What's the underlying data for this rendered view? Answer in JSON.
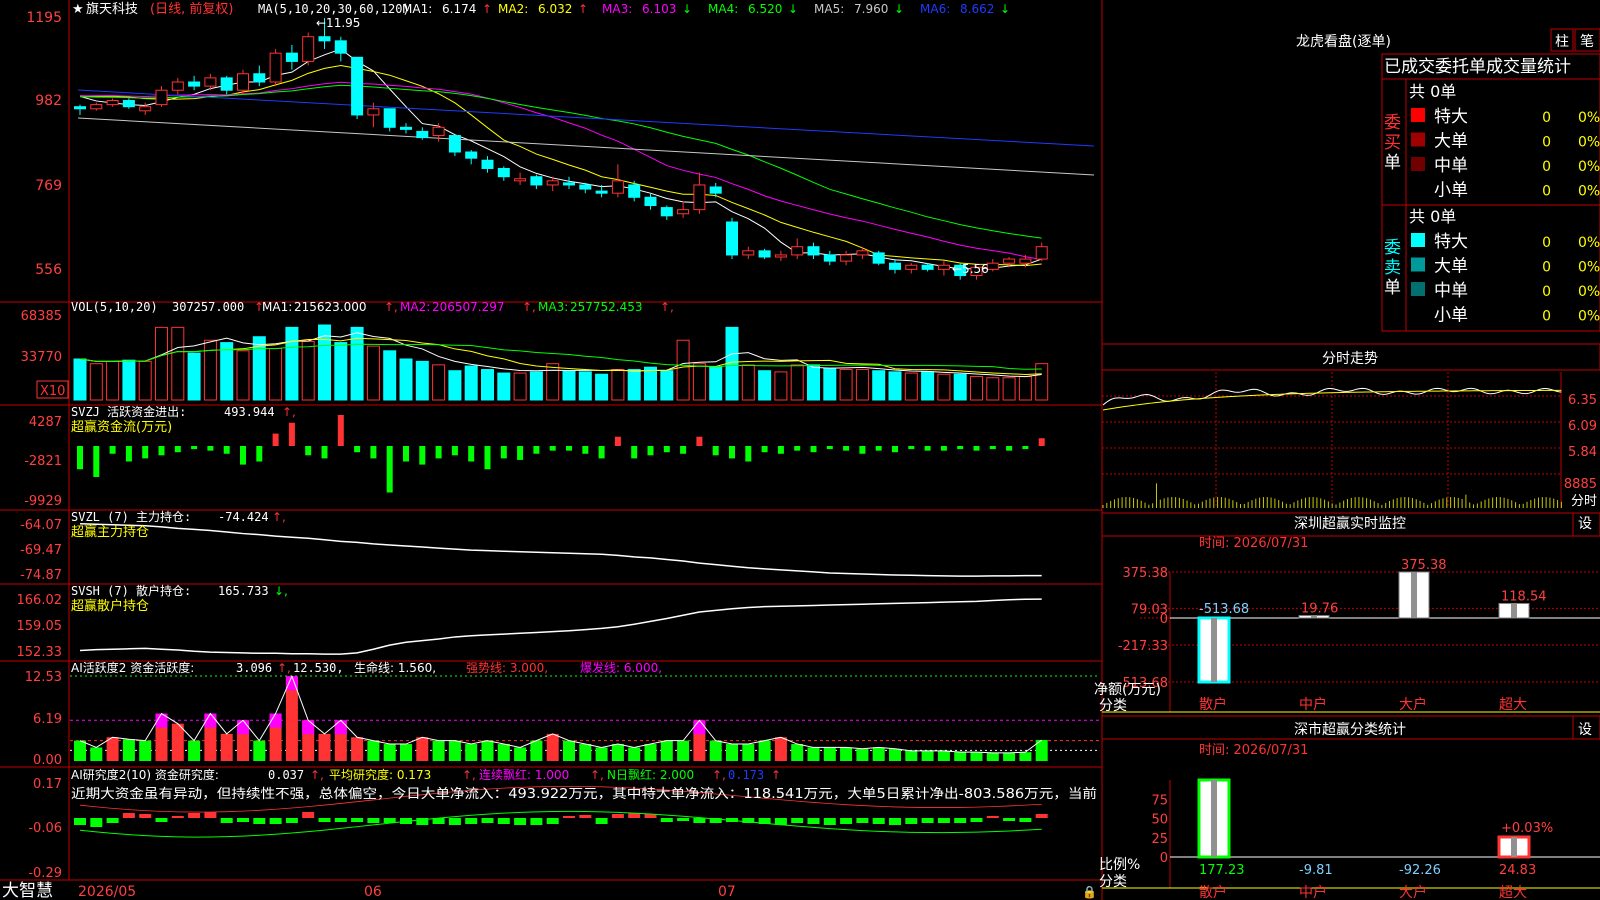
{
  "app": {
    "name": "大智慧",
    "logo_text": "☆"
  },
  "colors": {
    "up": "#ff3333",
    "down": "#00ffff",
    "frame": "#c00000",
    "axis_text": "#ff4040",
    "white": "#ffffff",
    "yellow": "#ffff00",
    "magenta": "#ff00ff",
    "green": "#00ff00",
    "blue": "#1e3cff",
    "gray": "#a0a0a0",
    "label_red": "#ff3333"
  },
  "main_panel": {
    "title_star": "★",
    "stock_name": "旗天科技",
    "period": "(日线, 前复权)",
    "ma_header": "MA(5,10,20,30,60,120)",
    "ma_items": [
      {
        "label": "MA1:",
        "value": "6.174",
        "arrow": "↑",
        "color": "#ffffff"
      },
      {
        "label": "MA2:",
        "value": "6.032",
        "arrow": "↑",
        "color": "#ffff00"
      },
      {
        "label": "MA3:",
        "value": "6.103",
        "arrow": "↓",
        "color": "#ff00ff"
      },
      {
        "label": "MA4:",
        "value": "6.520",
        "arrow": "↓",
        "color": "#00ff00"
      },
      {
        "label": "MA5:",
        "value": "7.960",
        "arrow": "↓",
        "color": "#c8c8c8"
      },
      {
        "label": "MA6:",
        "value": "8.662",
        "arrow": "↓",
        "color": "#1e3cff"
      }
    ],
    "high_note": "←11.95",
    "low_note": "←5.56",
    "y_ticks": [
      "1195",
      "982",
      "769",
      "556"
    ]
  },
  "vol_panel": {
    "header": "VOL(5,10,20)",
    "value": "307257.000",
    "items": [
      {
        "label": "MA1:",
        "value": "215623.000",
        "color": "#ffffff"
      },
      {
        "label": "MA2:",
        "value": "206507.297",
        "color": "#ff00ff"
      },
      {
        "label": "MA3:",
        "value": "257752.453",
        "color": "#00ff00"
      }
    ],
    "y_ticks": [
      "68385",
      "33770"
    ],
    "unit": "X10"
  },
  "svzj_panel": {
    "header": "SVZJ  活跃资金进出:",
    "value": "493.944",
    "subtitle": "超赢资金流(万元)",
    "y_ticks": [
      "4287",
      "-2821",
      "-9929"
    ]
  },
  "svzl_panel": {
    "header": "SVZL (7) 主力持仓:",
    "value": "-74.424",
    "subtitle": "超赢主力持仓",
    "y_ticks": [
      "-64.07",
      "-69.47",
      "-74.87"
    ]
  },
  "svsh_panel": {
    "header": "SVSH (7) 散户持仓:",
    "value": "165.733",
    "subtitle": "超赢散户持仓",
    "y_ticks": [
      "166.02",
      "159.05",
      "152.33"
    ]
  },
  "ai_active_panel": {
    "header": "AI活跃度2 资金活跃度:",
    "value": "3.096",
    "v2": "12.530,",
    "life_line": "生命线: 1.560,",
    "strong_line": "强势线: 3.000,",
    "burst_line": "爆发线: 6.000,",
    "y_ticks": [
      "12.53",
      "6.19",
      "0.00"
    ]
  },
  "ai_research_panel": {
    "header": "AI研究度2(10) 资金研究度:",
    "value": "0.037",
    "avg": "平均研究度: 0.173",
    "streak": "连续飘红: 1.000",
    "nday": "N日飘红: 2.000",
    "last": "0.173",
    "note": "近期大资金虽有异动，但持续性不强，总体偏空，今日大单净流入：493.922万元，其中特大单净流入：118.541万元，大单5日累计净出-803.586万元，当前",
    "y_ticks": [
      "0.17",
      "-0.06",
      "-0.29"
    ]
  },
  "date_axis": {
    "labels": [
      "2026/05",
      "06",
      "07"
    ]
  },
  "longhu": {
    "title": "龙虎看盘(逐单)",
    "tab1": "柱",
    "tab2": "笔",
    "header": "已成交委托单成交量统计",
    "buy_group": {
      "side_label": "委买单",
      "total": "共 0单",
      "rows": [
        {
          "name": "特大",
          "count": "0",
          "pct": "0%",
          "color": "#ff0000"
        },
        {
          "name": "大单",
          "count": "0",
          "pct": "0%",
          "color": "#a00000"
        },
        {
          "name": "中单",
          "count": "0",
          "pct": "0%",
          "color": "#700000"
        },
        {
          "name": "小单",
          "count": "0",
          "pct": "0%",
          "color": "#000000"
        }
      ]
    },
    "sell_group": {
      "side_label": "委卖单",
      "total": "共 0单",
      "rows": [
        {
          "name": "特大",
          "count": "0",
          "pct": "0%",
          "color": "#00ffff"
        },
        {
          "name": "大单",
          "count": "0",
          "pct": "0%",
          "color": "#009a9a"
        },
        {
          "name": "中单",
          "count": "0",
          "pct": "0%",
          "color": "#007070"
        },
        {
          "name": "小单",
          "count": "0",
          "pct": "0%",
          "color": "#000000"
        }
      ]
    }
  },
  "intraday": {
    "title": "分时走势",
    "y_ticks": [
      "6.35",
      "6.09",
      "5.84"
    ],
    "vol_tick": "8885",
    "vol_label": "分时"
  },
  "sz_monitor": {
    "title": "深圳超赢实时监控",
    "settings": "设",
    "time": "时间: 2026/07/31",
    "y_ticks": [
      "375.38",
      "79.03",
      "0",
      "-217.33",
      "-513.68"
    ],
    "y_unit": "净额(万元)",
    "x_title": "分类",
    "categories": [
      "散户",
      "中户",
      "大户",
      "超大"
    ],
    "values": [
      -513.68,
      19.76,
      375.38,
      118.54
    ],
    "value_labels": [
      "-513.68",
      "19.76",
      "375.38",
      "118.54"
    ]
  },
  "sz_classify": {
    "title": "深市超赢分类统计",
    "settings": "设",
    "time": "时间: 2026/07/31",
    "y_ticks": [
      "75",
      "50",
      "25",
      "0"
    ],
    "y_unit": "比例%",
    "x_title": "分类",
    "categories": [
      "散户",
      "中户",
      "大户",
      "超大"
    ],
    "values": [
      177.23,
      -9.81,
      -92.26,
      24.83
    ],
    "value_labels": [
      "177.23",
      "-9.81",
      "-92.26",
      "24.83"
    ],
    "extra_label": "+0.03%"
  },
  "chart_data": [
    {
      "type": "candlestick",
      "title": "旗天科技 (日线, 前复权)",
      "x": [
        "2026/05",
        "06",
        "07"
      ],
      "ohlc": [
        [
          9.8,
          9.85,
          9.6,
          9.75
        ],
        [
          9.75,
          9.9,
          9.7,
          9.85
        ],
        [
          9.85,
          10.0,
          9.8,
          9.95
        ],
        [
          9.95,
          10.0,
          9.75,
          9.8
        ],
        [
          9.7,
          9.9,
          9.6,
          9.8
        ],
        [
          9.85,
          10.3,
          9.8,
          10.2
        ],
        [
          10.2,
          10.5,
          10.1,
          10.4
        ],
        [
          10.4,
          10.55,
          10.2,
          10.3
        ],
        [
          10.3,
          10.6,
          10.2,
          10.5
        ],
        [
          10.5,
          10.55,
          10.1,
          10.2
        ],
        [
          10.2,
          10.7,
          10.1,
          10.6
        ],
        [
          10.6,
          10.8,
          10.3,
          10.4
        ],
        [
          10.4,
          11.2,
          10.3,
          11.1
        ],
        [
          11.1,
          11.3,
          10.7,
          10.9
        ],
        [
          10.9,
          11.6,
          10.8,
          11.5
        ],
        [
          11.5,
          11.95,
          11.2,
          11.4
        ],
        [
          11.4,
          11.5,
          10.9,
          11.1
        ],
        [
          11.0,
          11.0,
          9.5,
          9.6
        ],
        [
          9.6,
          9.9,
          9.3,
          9.75
        ],
        [
          9.75,
          9.75,
          9.2,
          9.3
        ],
        [
          9.3,
          9.4,
          9.15,
          9.25
        ],
        [
          9.2,
          9.3,
          9.0,
          9.05
        ],
        [
          9.1,
          9.4,
          8.95,
          9.3
        ],
        [
          9.1,
          9.1,
          8.6,
          8.7
        ],
        [
          8.7,
          8.75,
          8.4,
          8.55
        ],
        [
          8.5,
          8.6,
          8.2,
          8.3
        ],
        [
          8.3,
          8.35,
          8.0,
          8.1
        ],
        [
          8.0,
          8.2,
          7.9,
          8.05
        ],
        [
          8.1,
          8.15,
          7.8,
          7.9
        ],
        [
          7.9,
          8.1,
          7.75,
          8.0
        ],
        [
          7.95,
          8.1,
          7.8,
          7.9
        ],
        [
          7.9,
          7.95,
          7.7,
          7.8
        ],
        [
          7.75,
          7.9,
          7.6,
          7.7
        ],
        [
          7.7,
          8.4,
          7.6,
          8.0
        ],
        [
          7.9,
          8.0,
          7.5,
          7.6
        ],
        [
          7.6,
          7.7,
          7.3,
          7.4
        ],
        [
          7.35,
          7.4,
          7.05,
          7.15
        ],
        [
          7.2,
          7.5,
          7.1,
          7.3
        ],
        [
          7.3,
          8.2,
          7.2,
          7.9
        ],
        [
          7.85,
          7.95,
          7.6,
          7.7
        ],
        [
          7.0,
          7.1,
          6.1,
          6.2
        ],
        [
          6.2,
          6.4,
          6.1,
          6.3
        ],
        [
          6.3,
          6.35,
          6.1,
          6.15
        ],
        [
          6.15,
          6.3,
          6.05,
          6.2
        ],
        [
          6.2,
          6.6,
          6.1,
          6.4
        ],
        [
          6.4,
          6.5,
          6.1,
          6.2
        ],
        [
          6.2,
          6.3,
          5.95,
          6.05
        ],
        [
          6.05,
          6.3,
          5.95,
          6.2
        ],
        [
          6.2,
          6.4,
          6.1,
          6.3
        ],
        [
          6.25,
          6.3,
          5.95,
          6.0
        ],
        [
          6.0,
          6.1,
          5.75,
          5.85
        ],
        [
          5.85,
          6.0,
          5.75,
          5.95
        ],
        [
          5.95,
          6.0,
          5.8,
          5.85
        ],
        [
          5.85,
          6.05,
          5.7,
          5.95
        ],
        [
          5.95,
          6.0,
          5.6,
          5.7
        ],
        [
          5.7,
          5.95,
          5.6,
          5.9
        ],
        [
          5.85,
          6.1,
          5.8,
          6.0
        ],
        [
          6.0,
          6.15,
          5.9,
          6.1
        ],
        [
          6.0,
          6.2,
          5.9,
          6.1
        ],
        [
          6.1,
          6.5,
          6.05,
          6.4
        ]
      ],
      "ylim": [
        5.3,
        12.1
      ]
    },
    {
      "type": "bar",
      "title": "VOL(5,10,20)",
      "values": [
        35,
        31,
        33,
        34,
        33,
        62,
        62,
        40,
        51,
        49,
        42,
        54,
        44,
        62,
        50,
        64,
        49,
        62,
        46,
        42,
        35,
        33,
        30,
        25,
        29,
        26,
        23,
        23,
        24,
        31,
        25,
        24,
        22,
        26,
        26,
        28,
        25,
        51,
        31,
        28,
        62,
        30,
        25,
        24,
        30,
        30,
        27,
        26,
        26,
        25,
        24,
        23,
        24,
        22,
        22,
        20,
        19,
        19,
        20,
        31
      ]
    },
    {
      "type": "bar",
      "title": "SVZJ 活跃资金进出",
      "values": [
        -15,
        -20,
        -5,
        -10,
        -8,
        -6,
        -4,
        -2,
        -3,
        -5,
        -12,
        -10,
        8,
        15,
        -6,
        -8,
        20,
        -4,
        -8,
        -30,
        -10,
        -12,
        -8,
        -6,
        -10,
        -15,
        -8,
        -9,
        -5,
        -3,
        -3,
        -5,
        -8,
        6,
        -8,
        -6,
        -4,
        -5,
        6,
        -6,
        -8,
        -10,
        -4,
        -5,
        -3,
        -4,
        -2,
        -3,
        -5,
        -3,
        -4,
        -2,
        -3,
        -3,
        -2,
        -3,
        -2,
        -3,
        -2,
        5
      ]
    },
    {
      "type": "line",
      "title": "SVZL 主力持仓",
      "values": [
        -64.4,
        -64.5,
        -64.6,
        -64.7,
        -64.8,
        -65.0,
        -65.3,
        -65.5,
        -65.7,
        -66.0,
        -66.3,
        -66.5,
        -66.8,
        -67.0,
        -67.2,
        -67.5,
        -67.8,
        -68.0,
        -68.3,
        -68.5,
        -68.7,
        -68.9,
        -69.1,
        -69.3,
        -69.5,
        -69.6,
        -69.7,
        -69.8,
        -69.9,
        -70.0,
        -70.1,
        -70.2,
        -70.3,
        -70.5,
        -70.8,
        -71.0,
        -71.3,
        -71.6,
        -72.0,
        -72.3,
        -72.6,
        -72.9,
        -73.1,
        -73.3,
        -73.5,
        -73.7,
        -73.9,
        -74.0,
        -74.1,
        -74.2,
        -74.3,
        -74.35,
        -74.4,
        -74.45,
        -74.5,
        -74.5,
        -74.45,
        -74.45,
        -74.42,
        -74.42
      ],
      "ylim": [
        -74.87,
        -64.07
      ]
    },
    {
      "type": "line",
      "title": "SVSH 散户持仓",
      "values": [
        153.2,
        153.4,
        153.5,
        153.6,
        153.7,
        153.5,
        153.3,
        153.0,
        152.8,
        152.7,
        152.6,
        152.5,
        152.5,
        152.4,
        152.4,
        152.3,
        152.3,
        152.6,
        153.5,
        154.5,
        155.2,
        155.6,
        156.0,
        156.5,
        156.8,
        157.0,
        157.2,
        157.4,
        157.6,
        157.8,
        158.0,
        158.3,
        158.6,
        159.0,
        159.6,
        160.3,
        161.0,
        161.8,
        162.6,
        163.0,
        163.4,
        163.7,
        163.9,
        164.0,
        164.1,
        164.2,
        164.3,
        164.4,
        164.5,
        164.6,
        164.7,
        164.8,
        164.9,
        165.0,
        165.1,
        165.2,
        165.4,
        165.6,
        165.7,
        165.73
      ],
      "ylim": [
        152.33,
        166.02
      ]
    },
    {
      "type": "bar",
      "title": "AI活跃度2 资金活跃度",
      "values": [
        3.0,
        2.0,
        3.5,
        3.2,
        3.0,
        7.0,
        5.5,
        3.0,
        7.0,
        4.0,
        6.0,
        3.0,
        7.0,
        12.5,
        6.0,
        4.0,
        6.0,
        3.5,
        3.0,
        2.5,
        2.5,
        3.5,
        3.0,
        3.0,
        2.5,
        3.0,
        2.5,
        2.0,
        3.0,
        4.0,
        3.0,
        2.5,
        2.0,
        2.5,
        2.0,
        2.5,
        3.0,
        3.0,
        6.0,
        3.0,
        2.5,
        2.5,
        3.0,
        3.5,
        2.5,
        2.0,
        2.0,
        2.0,
        1.8,
        2.0,
        1.8,
        1.5,
        1.5,
        1.5,
        1.3,
        1.3,
        1.2,
        1.2,
        1.3,
        3.1
      ],
      "ylim": [
        0,
        12.53
      ]
    },
    {
      "type": "bar",
      "title": "AI研究度2(10) 资金研究度",
      "values": [
        -0.07,
        -0.09,
        -0.05,
        0.05,
        0.04,
        -0.04,
        0.02,
        0.05,
        0.06,
        -0.05,
        -0.04,
        -0.06,
        -0.06,
        -0.05,
        0.06,
        -0.04,
        -0.04,
        -0.04,
        -0.05,
        -0.05,
        -0.06,
        -0.07,
        -0.06,
        -0.07,
        -0.06,
        -0.05,
        -0.06,
        -0.07,
        -0.07,
        -0.06,
        0.02,
        0.03,
        -0.06,
        0.04,
        0.05,
        0.04,
        -0.04,
        -0.03,
        -0.05,
        -0.05,
        -0.04,
        -0.05,
        -0.06,
        -0.07,
        -0.05,
        -0.06,
        -0.07,
        -0.06,
        -0.05,
        -0.06,
        -0.07,
        -0.06,
        -0.05,
        -0.05,
        -0.05,
        -0.04,
        0.02,
        -0.03,
        -0.04,
        0.04
      ],
      "ylim": [
        -0.29,
        0.17
      ]
    },
    {
      "type": "bar",
      "title": "深圳超赢实时监控",
      "categories": [
        "散户",
        "中户",
        "大户",
        "超大"
      ],
      "values": [
        -513.68,
        19.76,
        375.38,
        118.54
      ],
      "ylabel": "净额(万元)"
    },
    {
      "type": "bar",
      "title": "深市超赢分类统计",
      "categories": [
        "散户",
        "中户",
        "大户",
        "超大"
      ],
      "values": [
        177.23,
        -9.81,
        -92.26,
        24.83
      ],
      "ylabel": "比例%"
    }
  ]
}
